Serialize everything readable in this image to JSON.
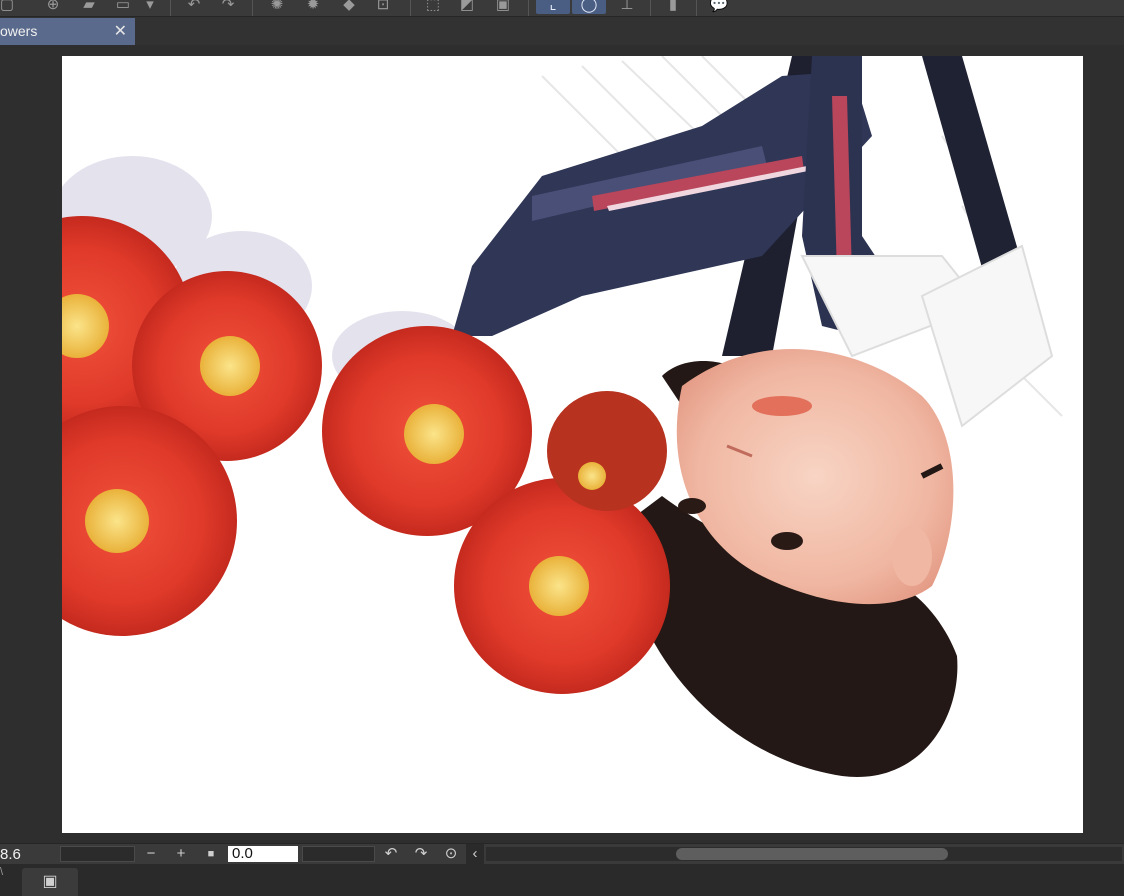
{
  "toolbar": {
    "icons": [
      "new-file-icon",
      "open-file-icon",
      "open-folder-icon",
      "save-icon",
      "undo-icon",
      "redo-icon",
      "loading-icon",
      "settings-icon",
      "fill-icon",
      "transform-icon",
      "select-all-icon",
      "deselect-icon",
      "crop-icon",
      "rotate-left-icon",
      "rotate-right-icon",
      "ruler-icon",
      "device-icon",
      "comment-icon"
    ]
  },
  "tab": {
    "title": "owers",
    "close_glyph": "✕"
  },
  "status": {
    "zoom": "8.6",
    "zoom_out": "−",
    "zoom_in": "+",
    "fit": "■",
    "angle": "0.0",
    "rotate_left": "↶",
    "rotate_right": "↷",
    "reset_rotation": "⊙",
    "collapse": "‹"
  },
  "bottom": {
    "panel_glyph": "▣",
    "corner_glyph": "\\"
  },
  "colors": {
    "accent": "#5a6a8c",
    "flower_red": "#e03a2a",
    "flower_center": "#f2c84a",
    "tie_navy": "#2f3656",
    "hair": "#231815",
    "skin": "#f4c3b1"
  }
}
